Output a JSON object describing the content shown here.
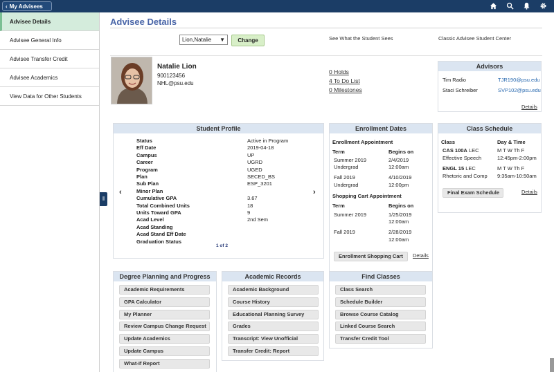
{
  "topbar": {
    "back_label": "My Advisees",
    "icons": [
      "home-icon",
      "search-icon",
      "bell-icon",
      "gear-icon"
    ]
  },
  "sidebar": {
    "items": [
      {
        "label": "Advisee Details"
      },
      {
        "label": "Advisee General Info"
      },
      {
        "label": "Advisee Transfer Credit"
      },
      {
        "label": "Advisee Academics"
      },
      {
        "label": "View Data for Other Students"
      }
    ]
  },
  "page": {
    "title": "Advisee Details"
  },
  "selector": {
    "value": "Lion,Natalie",
    "change_label": "Change",
    "see_link": "See What the Student Sees",
    "classic_link": "Classic Advisee Student Center"
  },
  "student": {
    "name": "Natalie Lion",
    "id": "900123456",
    "email": "NHL@psu.edu"
  },
  "links": {
    "holds": "0 Holds",
    "todo": "4 To Do List",
    "milestones": "0 Milestones"
  },
  "advisors": {
    "title": "Advisors",
    "rows": [
      {
        "name": "Tim Radio",
        "email": "TJR190@psu.edu"
      },
      {
        "name": "Staci Schreiber",
        "email": "SVP102@psu.edu"
      }
    ],
    "details": "Details"
  },
  "profile": {
    "title": "Student Profile",
    "rows": [
      {
        "label": "Status",
        "value": "Active in Program"
      },
      {
        "label": "Eff Date",
        "value": "2019-04-18"
      },
      {
        "label": "Campus",
        "value": "UP"
      },
      {
        "label": "Career",
        "value": "UGRD"
      },
      {
        "label": "Program",
        "value": "UGED"
      },
      {
        "label": "Plan",
        "value": "SECED_BS"
      },
      {
        "label": "Sub Plan",
        "value": "ESP_3201"
      },
      {
        "label": "Minor Plan",
        "value": ""
      },
      {
        "label": "Cumulative GPA",
        "value": "3.67"
      },
      {
        "label": "Total Combined Units",
        "value": "18"
      },
      {
        "label": "Units Toward GPA",
        "value": "9"
      },
      {
        "label": "Acad Level",
        "value": "2nd Sem"
      },
      {
        "label": "Acad Standing",
        "value": ""
      },
      {
        "label": "Acad Stand Eff Date",
        "value": ""
      },
      {
        "label": "Graduation Status",
        "value": ""
      }
    ],
    "pager": "1 of 2"
  },
  "enrollment": {
    "title": "Enrollment Dates",
    "appt_title": "Enrollment Appointment",
    "term_h": "Term",
    "begins_h": "Begins on",
    "appts": [
      {
        "term1": "Summer 2019",
        "term2": "Undergrad",
        "date": "2/4/2019",
        "time": "12:00am"
      },
      {
        "term1": "Fall 2019",
        "term2": "Undergrad",
        "date": "4/10/2019",
        "time": "12:00pm"
      }
    ],
    "cart_title": "Shopping Cart Appointment",
    "carts": [
      {
        "term": "Summer 2019",
        "date": "1/25/2019",
        "time": "12:00am"
      },
      {
        "term": "Fall 2019",
        "date": "2/28/2019",
        "time": "12:00am"
      }
    ],
    "cart_btn": "Enrollment Shopping Cart",
    "details": "Details"
  },
  "schedule": {
    "title": "Class Schedule",
    "class_h": "Class",
    "time_h": "Day & Time",
    "classes": [
      {
        "code": "CAS 100A",
        "type": "LEC",
        "name": "Effective Speech",
        "days": "M T W Th F",
        "time": "12:45pm-2:00pm"
      },
      {
        "code": "ENGL 15",
        "type": "LEC",
        "name": "Rhetoric and Comp",
        "days": "M T W Th F",
        "time": "9:35am-10:50am"
      }
    ],
    "final_btn": "Final Exam Schedule",
    "details": "Details"
  },
  "degree": {
    "title": "Degree Planning and Progress",
    "buttons": [
      "Academic Requirements",
      "GPA Calculator",
      "My Planner",
      "Review Campus Change Request",
      "Update Academics",
      "Update Campus",
      "What-If Report"
    ]
  },
  "records": {
    "title": "Academic Records",
    "buttons": [
      "Academic Background",
      "Course History",
      "Educational Planning Survey",
      "Grades",
      "Transcript: View Unofficial",
      "Transfer Credit: Report"
    ]
  },
  "find": {
    "title": "Find Classes",
    "buttons": [
      "Class Search",
      "Schedule Builder",
      "Browse Course Catalog",
      "Linked Course Search",
      "Transfer Credit Tool"
    ]
  }
}
